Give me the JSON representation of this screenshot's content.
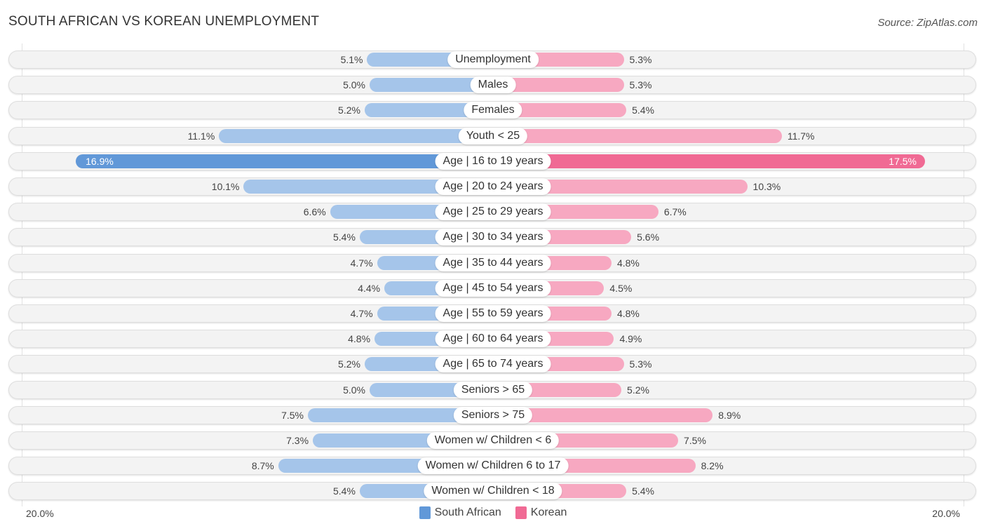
{
  "header": {
    "title": "SOUTH AFRICAN VS KOREAN UNEMPLOYMENT",
    "source": "Source: ZipAtlas.com"
  },
  "colors": {
    "south_african": "#a5c5ea",
    "south_african_highlight": "#6198d8",
    "korean": "#f7a8c1",
    "korean_highlight": "#f06a94",
    "legend_south_african": "#6198d8",
    "legend_korean": "#f06a94"
  },
  "chart_data": {
    "type": "bar",
    "orientation": "horizontal-diverging",
    "title": "SOUTH AFRICAN VS KOREAN UNEMPLOYMENT",
    "xlabel": "",
    "ylabel": "",
    "xlim": [
      -20,
      20
    ],
    "axis_labels": {
      "left": "20.0%",
      "right": "20.0%"
    },
    "legend": {
      "position": "bottom-center",
      "entries": [
        "South African",
        "Korean"
      ]
    },
    "categories": [
      "Unemployment",
      "Males",
      "Females",
      "Youth < 25",
      "Age | 16 to 19 years",
      "Age | 20 to 24 years",
      "Age | 25 to 29 years",
      "Age | 30 to 34 years",
      "Age | 35 to 44 years",
      "Age | 45 to 54 years",
      "Age | 55 to 59 years",
      "Age | 60 to 64 years",
      "Age | 65 to 74 years",
      "Seniors > 65",
      "Seniors > 75",
      "Women w/ Children < 6",
      "Women w/ Children 6 to 17",
      "Women w/ Children < 18"
    ],
    "series": [
      {
        "name": "South African",
        "side": "left",
        "values": [
          5.1,
          5.0,
          5.2,
          11.1,
          16.9,
          10.1,
          6.6,
          5.4,
          4.7,
          4.4,
          4.7,
          4.8,
          5.2,
          5.0,
          7.5,
          7.3,
          8.7,
          5.4
        ],
        "labels": [
          "5.1%",
          "5.0%",
          "5.2%",
          "11.1%",
          "16.9%",
          "10.1%",
          "6.6%",
          "5.4%",
          "4.7%",
          "4.4%",
          "4.7%",
          "4.8%",
          "5.2%",
          "5.0%",
          "7.5%",
          "7.3%",
          "8.7%",
          "5.4%"
        ]
      },
      {
        "name": "Korean",
        "side": "right",
        "values": [
          5.3,
          5.3,
          5.4,
          11.7,
          17.5,
          10.3,
          6.7,
          5.6,
          4.8,
          4.5,
          4.8,
          4.9,
          5.3,
          5.2,
          8.9,
          7.5,
          8.2,
          5.4
        ],
        "labels": [
          "5.3%",
          "5.3%",
          "5.4%",
          "11.7%",
          "17.5%",
          "10.3%",
          "6.7%",
          "5.6%",
          "4.8%",
          "4.5%",
          "4.8%",
          "4.9%",
          "5.3%",
          "5.2%",
          "8.9%",
          "7.5%",
          "8.2%",
          "5.4%"
        ]
      }
    ],
    "highlighted_category": "Age | 16 to 19 years"
  }
}
